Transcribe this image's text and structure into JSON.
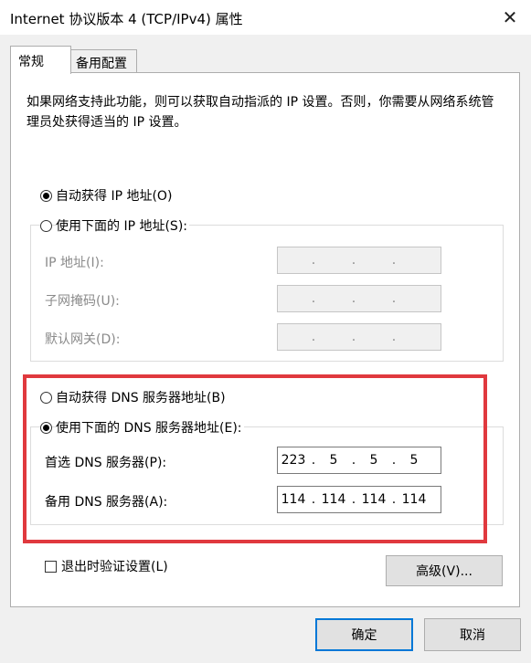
{
  "window": {
    "title": "Internet 协议版本 4 (TCP/IPv4) 属性",
    "close_glyph": "✕"
  },
  "tabs": [
    {
      "label": "常规"
    },
    {
      "label": "备用配置"
    }
  ],
  "description": "如果网络支持此功能，则可以获取自动指派的 IP 设置。否则，你需要从网络系统管理员处获得适当的 IP 设置。",
  "ip": {
    "auto_label": "自动获得 IP 地址(O)",
    "manual_label": "使用下面的 IP 地址(S):",
    "fields": [
      {
        "label": "IP 地址(I):",
        "octets": [
          "",
          "",
          "",
          ""
        ]
      },
      {
        "label": "子网掩码(U):",
        "octets": [
          "",
          "",
          "",
          ""
        ]
      },
      {
        "label": "默认网关(D):",
        "octets": [
          "",
          "",
          "",
          ""
        ]
      }
    ]
  },
  "dns": {
    "auto_label": "自动获得 DNS 服务器地址(B)",
    "manual_label": "使用下面的 DNS 服务器地址(E):",
    "fields": [
      {
        "label": "首选 DNS 服务器(P):",
        "octets": [
          "223",
          "5",
          "5",
          "5"
        ]
      },
      {
        "label": "备用 DNS 服务器(A):",
        "octets": [
          "114",
          "114",
          "114",
          "114"
        ]
      }
    ]
  },
  "validate_label": "退出时验证设置(L)",
  "buttons": {
    "advanced": "高级(V)...",
    "ok": "确定",
    "cancel": "取消"
  },
  "ip_separator": ".",
  "colors": {
    "highlight": "#e0393e",
    "primary_border": "#0078d7"
  }
}
